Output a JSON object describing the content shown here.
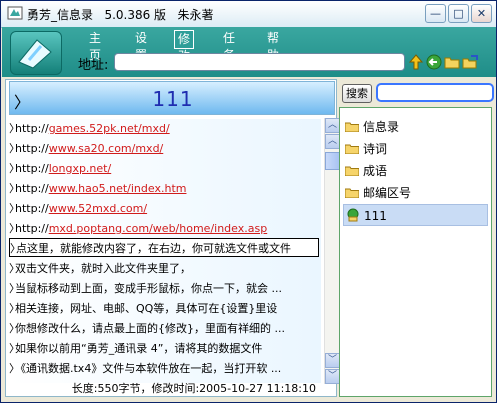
{
  "window": {
    "title": "勇芳_信息录   5.0.386 版   朱永著",
    "minimize_glyph": "—",
    "maximize_glyph": "□",
    "close_glyph": "✕"
  },
  "menu": [
    "主页",
    "设置",
    "修改",
    "任务",
    "帮助"
  ],
  "address": {
    "label": "地址:",
    "value": ""
  },
  "nav_icons": [
    "up-arrow-icon",
    "back-arrow-icon",
    "folder-open-icon",
    "folder-go-icon"
  ],
  "note": {
    "title": "111",
    "caret": "〉",
    "lines": [
      {
        "text": "http://",
        "link": "games.52pk.net/mxd/"
      },
      {
        "text": "http://",
        "link": "www.sa20.com/mxd/"
      },
      {
        "text": "http://",
        "link": "longxp.net/"
      },
      {
        "text": "http://",
        "link": "www.hao5.net/index.htm"
      },
      {
        "text": "http://",
        "link": "www.52mxd.com/"
      },
      {
        "text": "http://",
        "link": "mxd.poptang.com/web/home/index.asp"
      },
      {
        "text": "点这里，就能修改内容了，在右边，你可就选文件或文件",
        "link": ""
      },
      {
        "text": "双击文件夹，就时入此文件夹里了，",
        "link": ""
      },
      {
        "text": "当鼠标移动到上面，变成手形鼠标，你点一下，就会 ...",
        "link": ""
      },
      {
        "text": "相关连接，网址、电邮、QQ等，具体可在{设置}里设",
        "link": ""
      },
      {
        "text": "你想修改什么，请点最上面的{修改}，里面有祥细的 ...",
        "link": ""
      },
      {
        "text": "如果你以前用“勇芳_通讯录 4”，请将其的数据文件",
        "link": ""
      },
      {
        "text": "《通讯数据.tx4》文件与本软件放在一起，当打开软 ...",
        "link": ""
      }
    ],
    "selected_index": 6,
    "status": "长度:550字节，修改时间:2005-10-27 11:18:10"
  },
  "search": {
    "button": "搜索",
    "value": ""
  },
  "tree": {
    "items": [
      "信息录",
      "诗词",
      "成语",
      "邮编区号",
      "111"
    ],
    "selected_index": 4
  },
  "colors": {
    "accent": "#1f8d88",
    "link": "#d11b1b",
    "title_text": "#1f2db0"
  }
}
